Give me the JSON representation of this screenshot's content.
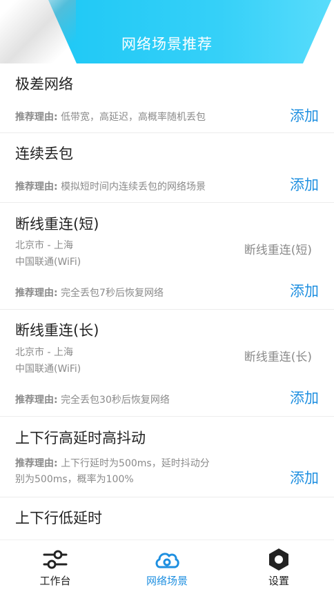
{
  "header": {
    "title": "网络场景推荐"
  },
  "reason_label": "推荐理由:",
  "add_label": "添加",
  "items": [
    {
      "name": "极差网络",
      "reason": "低带宽，高延迟，高概率随机丢包"
    },
    {
      "name": "连续丢包",
      "reason": "模拟短时间内连续丢包的网络场景"
    },
    {
      "name": "断线重连(短)",
      "city": "北京市 - 上海",
      "carrier": "中国联通(WiFi)",
      "tag": "断线重连(短)",
      "reason": "完全丢包7秒后恢复网络"
    },
    {
      "name": "断线重连(长)",
      "city": "北京市 - 上海",
      "carrier": "中国联通(WiFi)",
      "tag": "断线重连(长)",
      "reason": "完全丢包30秒后恢复网络"
    },
    {
      "name": "上下行高延时高抖动",
      "reason_line1": "上下行延时为500ms，延时抖动分",
      "reason_line2": "别为500ms，概率为100%"
    },
    {
      "name": "上下行低延时"
    }
  ],
  "tabs": [
    {
      "label": "工作台",
      "icon": "sliders-icon",
      "active": false
    },
    {
      "label": "网络场景",
      "icon": "cloud-icon",
      "active": true
    },
    {
      "label": "设置",
      "icon": "settings-hexagon-icon",
      "active": false
    }
  ],
  "colors": {
    "accent": "#1e8fe0",
    "banner": "#35d0f8",
    "muted": "#8a8a8a"
  }
}
